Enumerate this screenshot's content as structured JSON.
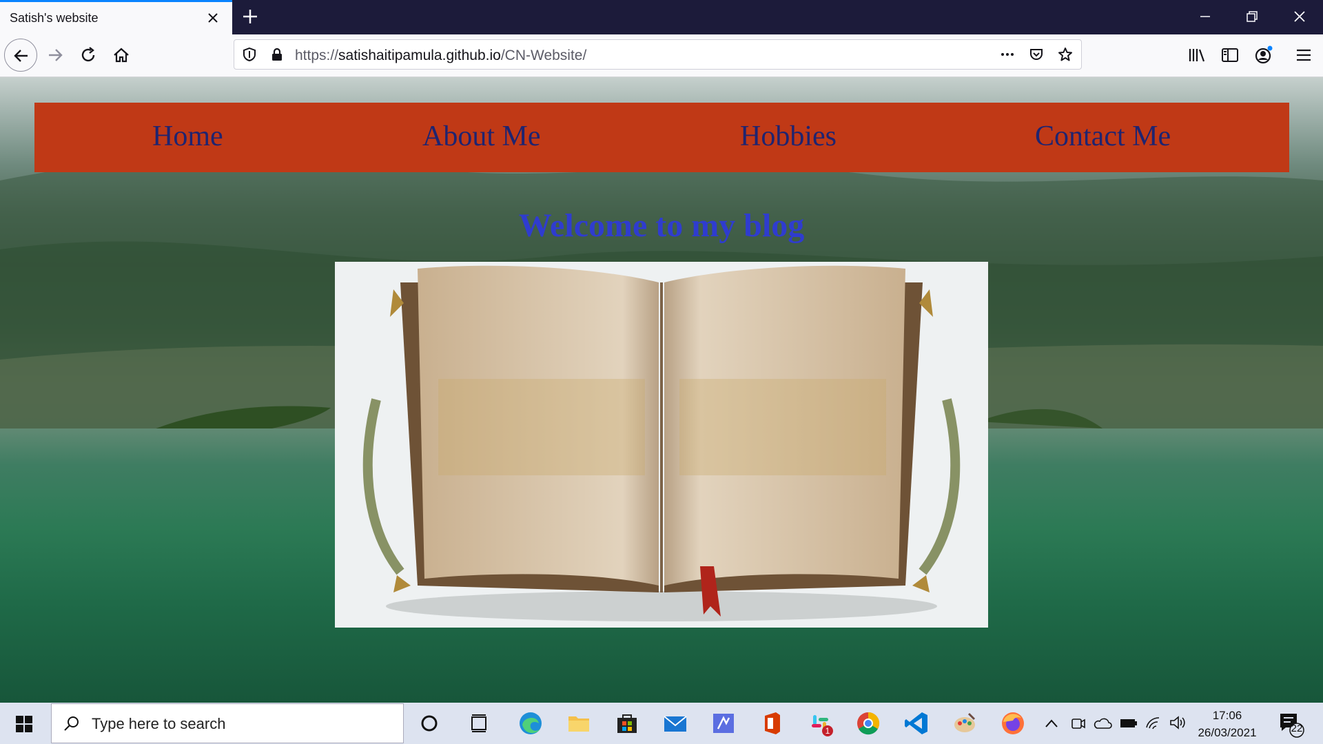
{
  "browser": {
    "tab_title": "Satish's website",
    "url_prefix": "https://",
    "url_domain": "satishaitipamula.github.io",
    "url_path": "/CN-Website/",
    "accent": "#0a84ff"
  },
  "site": {
    "nav": [
      "Home",
      "About Me",
      "Hobbies",
      "Contact Me"
    ],
    "heading": "Welcome to my blog",
    "nav_bg": "#c03916",
    "nav_text_color": "#1f2470",
    "heading_color": "#2f3ccf"
  },
  "taskbar": {
    "search_placeholder": "Type here to search",
    "time": "17:06",
    "date": "26/03/2021",
    "notification_count": "22",
    "slack_badge": "1",
    "icons": [
      "windows-start-icon",
      "search-icon",
      "cortana-icon",
      "task-view-icon",
      "edge-icon",
      "file-explorer-icon",
      "store-icon",
      "mail-icon",
      "app-icon",
      "office-icon",
      "slack-icon",
      "chrome-icon",
      "vscode-icon",
      "paint-icon",
      "firefox-icon",
      "chevron-up-icon",
      "meet-now-icon",
      "onedrive-icon",
      "battery-icon",
      "wifi-icon",
      "volume-icon",
      "notifications-icon"
    ]
  }
}
